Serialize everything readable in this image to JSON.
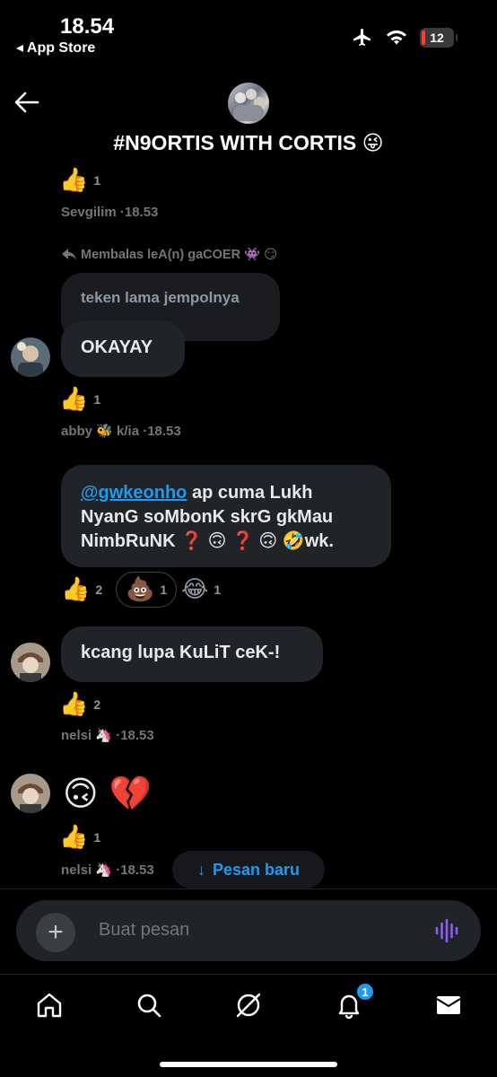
{
  "status": {
    "time": "18.54",
    "back_app": "◂ App Store",
    "battery": "12"
  },
  "header": {
    "title": "#N9ORTIS WITH CORTIS 😜"
  },
  "messages": {
    "top_reaction": {
      "emoji": "👍",
      "count": "1"
    },
    "top_meta": "Sevgilim ·18.53",
    "reply_meta": "Membalas leA(n) gaCOER 👾 😏",
    "quoted_text": "teken lama jempolnya",
    "okayay": {
      "text": "OKAYAY",
      "reaction": "👍",
      "count": "1",
      "meta": "abby 🐝 k/ia ·18.53"
    },
    "long": {
      "mention": "@gwkeonho",
      "line1": " ap cuma Lukh",
      "line2": "NyanG soMbonK skrG gkMau",
      "line3": "NimbRuNK ❓ 🙃 ❓ 🙃 🤣wk.",
      "reactions": [
        {
          "emoji": "👍",
          "count": "2"
        },
        {
          "emoji": "💩",
          "count": "1"
        },
        {
          "emoji": "😂",
          "count": "1"
        }
      ]
    },
    "kacang": {
      "text": "kcang lupa KuLiT ceK-!",
      "reaction": "👍",
      "count": "2",
      "meta": "nelsi 🦄 ·18.53"
    },
    "emoji_msg": {
      "text": "🙃 💔",
      "reaction": "👍",
      "count": "1",
      "meta": "nelsi 🦄 ·18.53"
    }
  },
  "new_message_button": {
    "arrow": "↓",
    "label": "Pesan baru"
  },
  "composer": {
    "placeholder": "Buat pesan",
    "plus": "+"
  },
  "tabbar": {
    "notification_badge": "1"
  },
  "colors": {
    "accent": "#1d9bf0",
    "bubble": "#202327",
    "background": "#000000",
    "voice": "#8b5cf6"
  }
}
